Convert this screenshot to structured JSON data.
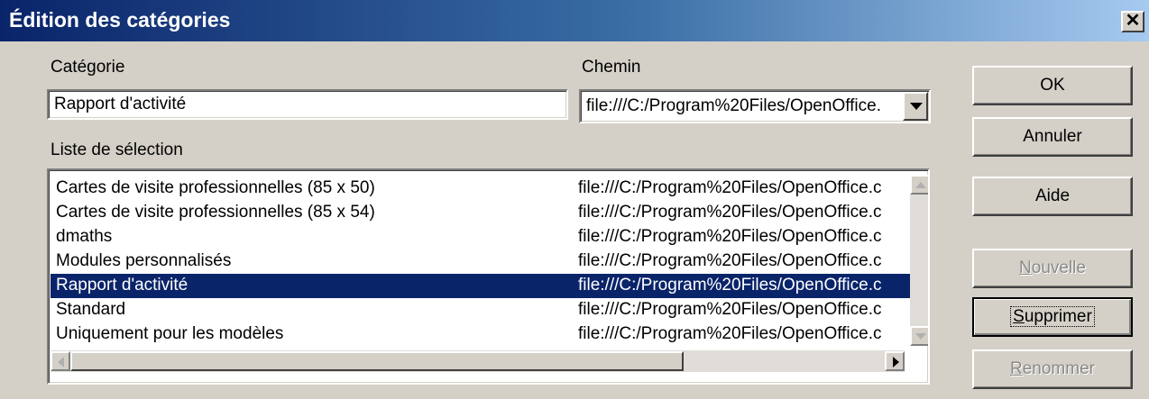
{
  "window": {
    "title": "Édition des catégories",
    "close_glyph": "✕"
  },
  "labels": {
    "category": "Catégorie",
    "path": "Chemin",
    "selection_list": "Liste de sélection"
  },
  "fields": {
    "category_value": "Rapport d'activité",
    "path_value": "file:///C:/Program%20Files/OpenOffice."
  },
  "list": {
    "rows": [
      {
        "name": "Cartes de visite professionnelles (85 x 50)",
        "path": "file:///C:/Program%20Files/OpenOffice.c",
        "selected": false
      },
      {
        "name": "Cartes de visite professionnelles (85 x 54)",
        "path": "file:///C:/Program%20Files/OpenOffice.c",
        "selected": false
      },
      {
        "name": "dmaths",
        "path": "file:///C:/Program%20Files/OpenOffice.c",
        "selected": false
      },
      {
        "name": "Modules personnalisés",
        "path": "file:///C:/Program%20Files/OpenOffice.c",
        "selected": false
      },
      {
        "name": "Rapport d'activité",
        "path": "file:///C:/Program%20Files/OpenOffice.c",
        "selected": true
      },
      {
        "name": "Standard",
        "path": "file:///C:/Program%20Files/OpenOffice.c",
        "selected": false
      },
      {
        "name": "Uniquement pour les modèles",
        "path": "file:///C:/Program%20Files/OpenOffice.c",
        "selected": false
      }
    ]
  },
  "buttons": {
    "ok": {
      "label": "OK",
      "enabled": true
    },
    "cancel": {
      "label": "Annuler",
      "enabled": true
    },
    "help": {
      "label": "Aide",
      "enabled": true
    },
    "new": {
      "accel": "N",
      "rest": "ouvelle",
      "enabled": false
    },
    "delete": {
      "accel": "S",
      "rest": "upprimer",
      "enabled": true,
      "focused": true
    },
    "rename": {
      "accel": "R",
      "rest": "enommer",
      "enabled": false
    }
  },
  "colors": {
    "title_start": "#0a246a",
    "title_end": "#a6caf0",
    "face": "#d4d0c8",
    "selection": "#0a246a"
  }
}
